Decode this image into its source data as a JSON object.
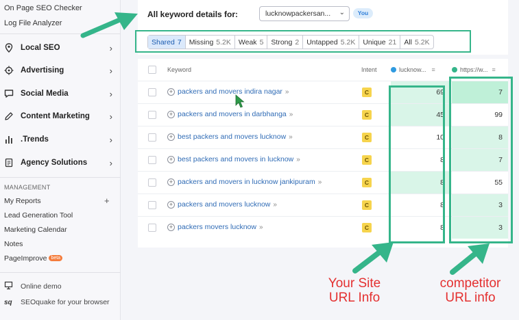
{
  "sidebar": {
    "top_links": [
      "On Page SEO Checker",
      "Log File Analyzer"
    ],
    "items": [
      {
        "label": "Local SEO",
        "icon": "location-pin-icon"
      },
      {
        "label": "Advertising",
        "icon": "target-icon"
      },
      {
        "label": "Social Media",
        "icon": "chat-bubble-icon"
      },
      {
        "label": "Content Marketing",
        "icon": "pencil-icon"
      },
      {
        "label": ".Trends",
        "icon": "bar-chart-icon"
      },
      {
        "label": "Agency Solutions",
        "icon": "document-icon"
      }
    ],
    "management_heading": "MANAGEMENT",
    "management_links": [
      "My Reports",
      "Lead Generation Tool",
      "Marketing Calendar",
      "Notes",
      "PageImprove"
    ],
    "beta_label": "beta",
    "bottom_links": [
      {
        "label": "Online demo",
        "icon": "presentation-icon"
      },
      {
        "label": "SEOquake for your browser",
        "icon": "sq"
      }
    ]
  },
  "header": {
    "title": "All keyword details for:",
    "domain": "lucknowpackersan...",
    "you_badge": "You"
  },
  "tabs": [
    {
      "label": "Shared",
      "count": "7",
      "active": true
    },
    {
      "label": "Missing",
      "count": "5.2K"
    },
    {
      "label": "Weak",
      "count": "5"
    },
    {
      "label": "Strong",
      "count": "2"
    },
    {
      "label": "Untapped",
      "count": "5.2K"
    },
    {
      "label": "Unique",
      "count": "21"
    },
    {
      "label": "All",
      "count": "5.2K"
    }
  ],
  "table": {
    "headers": {
      "keyword": "Keyword",
      "intent": "Intent",
      "col1": "lucknow...",
      "col2": "https://w..."
    },
    "col1_color": "#2f9ae0",
    "col2_color": "#35b58a",
    "rows": [
      {
        "keyword": "packers and movers indira nagar",
        "intent": "C",
        "v1": "69",
        "v2": "7"
      },
      {
        "keyword": "packers and movers in darbhanga",
        "intent": "C",
        "v1": "45",
        "v2": "99"
      },
      {
        "keyword": "best packers and movers lucknow",
        "intent": "C",
        "v1": "10",
        "v2": "8"
      },
      {
        "keyword": "best packers and movers in lucknow",
        "intent": "C",
        "v1": "8",
        "v2": "7"
      },
      {
        "keyword": "packers and movers in lucknow jankipuram",
        "intent": "C",
        "v1": "8",
        "v2": "55"
      },
      {
        "keyword": "packers and movers lucknow",
        "intent": "C",
        "v1": "8",
        "v2": "3"
      },
      {
        "keyword": "packers movers lucknow",
        "intent": "C",
        "v1": "8",
        "v2": "3"
      }
    ]
  },
  "annotations": {
    "your_site_line1": "Your Site",
    "your_site_line2": "URL Info",
    "competitor_line1": "competitor",
    "competitor_line2": "URL info"
  }
}
